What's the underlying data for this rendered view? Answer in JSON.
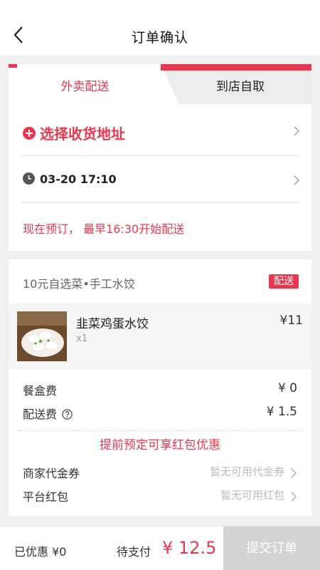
{
  "header": {
    "title": "订单确认"
  },
  "tabs": {
    "delivery": "外卖配送",
    "pickup": "到店自取"
  },
  "address": {
    "label": "选择收货地址"
  },
  "time": {
    "value": "03-20 17:10"
  },
  "notice": "现在预订， 最早16:30开始配送",
  "shop": {
    "name": "10元自选菜•手工水饺",
    "badge": "配送"
  },
  "item": {
    "name": "韭菜鸡蛋水饺",
    "qty": "x1",
    "price": "¥11"
  },
  "fees": {
    "box_label": "餐盒费",
    "box_value": "¥ 0",
    "delivery_label": "配送费",
    "delivery_value": "¥ 1.5"
  },
  "promo": "提前预定可享红包优惠",
  "options": {
    "voucher_label": "商家代金券",
    "voucher_value": "暂无可用代金券",
    "redpacket_label": "平台红包",
    "redpacket_value": "暂无可用红包"
  },
  "footer": {
    "saved": "已优惠  ¥0",
    "topay_label": "待支付",
    "topay_value": "¥ 12.5",
    "submit": "提交订单"
  },
  "colors": {
    "accent": "#e8384f",
    "disabled": "#d3d3d3"
  }
}
